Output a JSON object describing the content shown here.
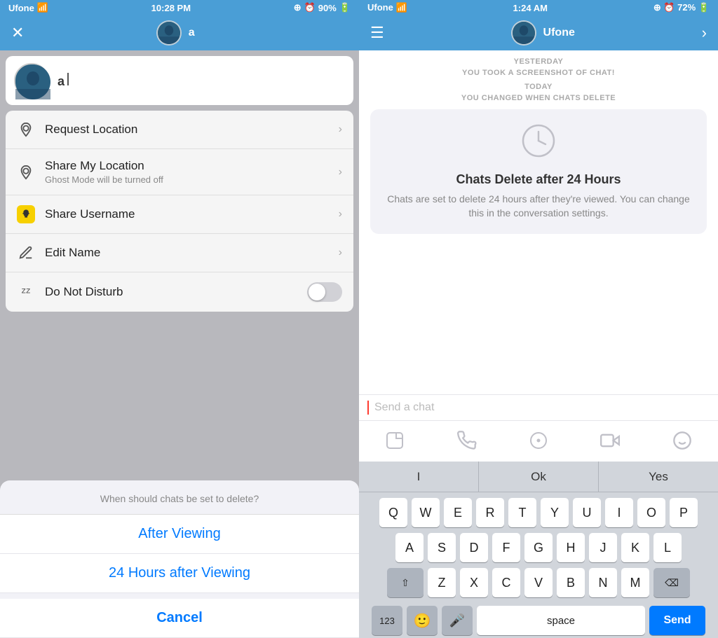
{
  "left": {
    "status_bar": {
      "carrier": "Ufone",
      "time": "10:28 PM",
      "battery": "90%"
    },
    "nav": {
      "username": "a"
    },
    "contact": {
      "name": "a"
    },
    "menu_items": [
      {
        "id": "request-location",
        "icon": "📍",
        "title": "Request Location",
        "subtitle": "",
        "type": "chevron"
      },
      {
        "id": "share-location",
        "icon": "📍",
        "title": "Share My Location",
        "subtitle": "Ghost Mode will be turned off",
        "type": "chevron"
      },
      {
        "id": "share-username",
        "icon": "👻",
        "title": "Share Username",
        "subtitle": "",
        "type": "chevron"
      },
      {
        "id": "edit-name",
        "icon": "✏️",
        "title": "Edit Name",
        "subtitle": "",
        "type": "chevron"
      },
      {
        "id": "do-not-disturb",
        "icon": "💤",
        "title": "Do Not Disturb",
        "subtitle": "",
        "type": "toggle"
      }
    ],
    "action_sheet": {
      "title": "When should chats be set to delete?",
      "options": [
        "After Viewing",
        "24 Hours after Viewing"
      ],
      "cancel": "Cancel"
    }
  },
  "right": {
    "status_bar": {
      "carrier": "Ufone",
      "time": "1:24 AM",
      "battery": "72%"
    },
    "chat": {
      "date_yesterday": "YESTERDAY",
      "screenshot_msg": "YOU TOOK A SCREENSHOT OF CHAT!",
      "date_today": "TODAY",
      "changed_msg": "YOU CHANGED WHEN CHATS DELETE",
      "card_title": "Chats Delete after 24 Hours",
      "card_desc": "Chats are set to delete 24 hours after they're viewed. You can change this in the conversation settings."
    },
    "input": {
      "placeholder": "Send a chat"
    },
    "keyboard": {
      "suggestions": [
        "I",
        "Ok",
        "Yes"
      ],
      "row1": [
        "Q",
        "W",
        "E",
        "R",
        "T",
        "Y",
        "U",
        "I",
        "O",
        "P"
      ],
      "row2": [
        "A",
        "S",
        "D",
        "F",
        "G",
        "H",
        "J",
        "K",
        "L"
      ],
      "row3": [
        "Z",
        "X",
        "C",
        "V",
        "B",
        "N",
        "M"
      ],
      "send_label": "Send",
      "space_label": "space",
      "nums_label": "123"
    }
  }
}
